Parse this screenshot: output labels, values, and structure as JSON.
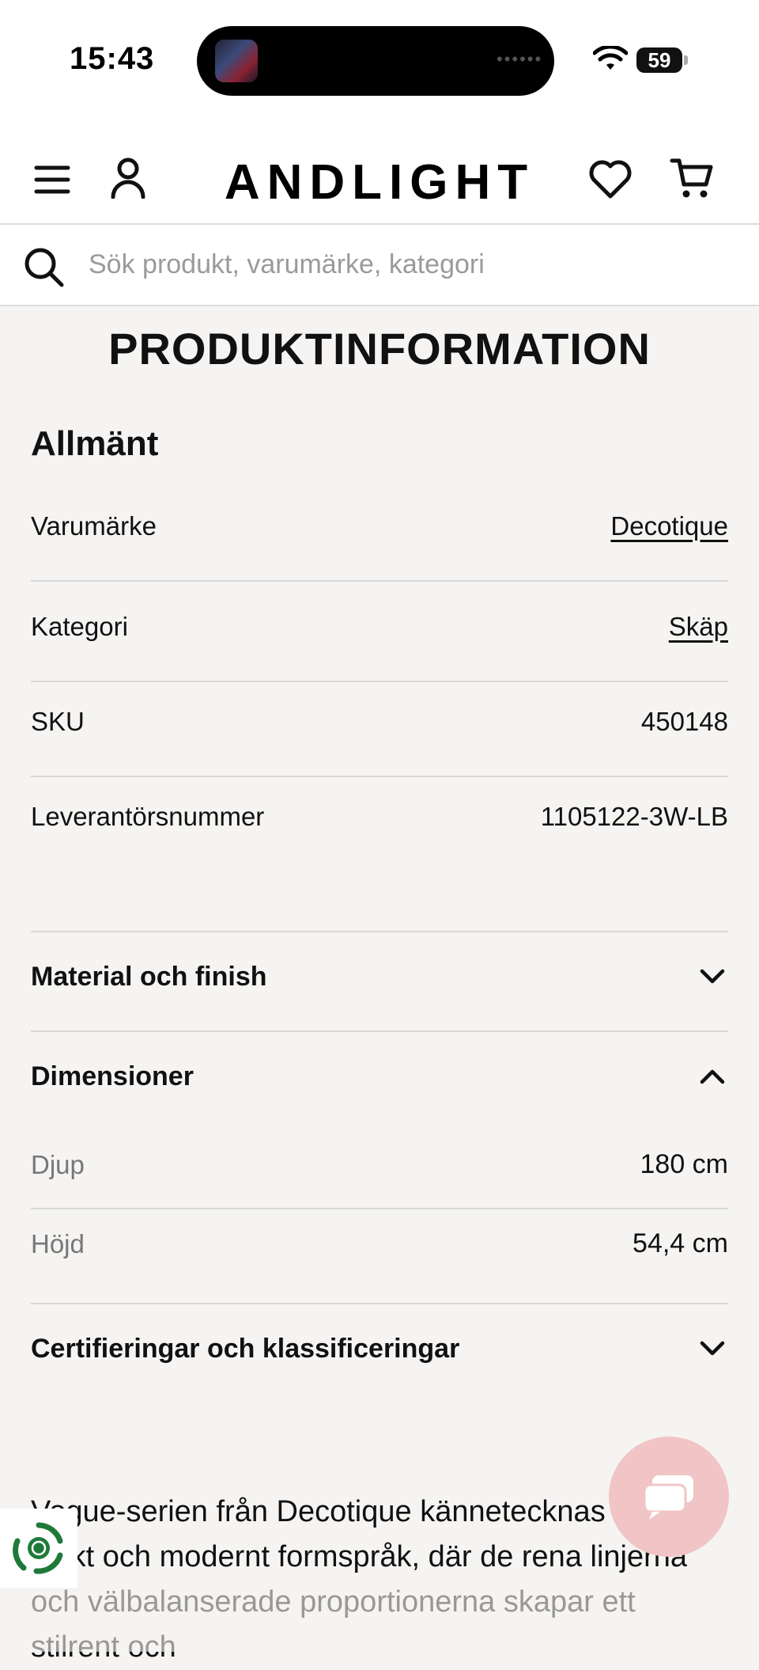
{
  "status_bar": {
    "time": "15:43",
    "battery": "59"
  },
  "header": {
    "logo": "ANDLIGHT"
  },
  "search": {
    "placeholder": "Sök produkt, varumärke, kategori"
  },
  "page_title": "PRODUKTINFORMATION",
  "general": {
    "title": "Allmänt",
    "rows": [
      {
        "label": "Varumärke",
        "value": "Decotique"
      },
      {
        "label": "Kategori",
        "value": "Skäp"
      },
      {
        "label": "SKU",
        "value": "450148"
      },
      {
        "label": "Leverantörsnummer",
        "value": "1105122-3W-LB"
      }
    ]
  },
  "accordions": {
    "material": "Material och finish",
    "dimensions": "Dimensioner",
    "certifications": "Certifieringar och klassificeringar"
  },
  "dimensions": [
    {
      "label": "Djup",
      "value": "180 cm"
    },
    {
      "label": "Höjd",
      "value": "54,4 cm"
    }
  ],
  "description": "Vogue-serien från Decotique kännetecknas av ett strikt och modernt formspråk, där de rena linjerna och välbalanserade proportionerna skapar ett stilrent och"
}
